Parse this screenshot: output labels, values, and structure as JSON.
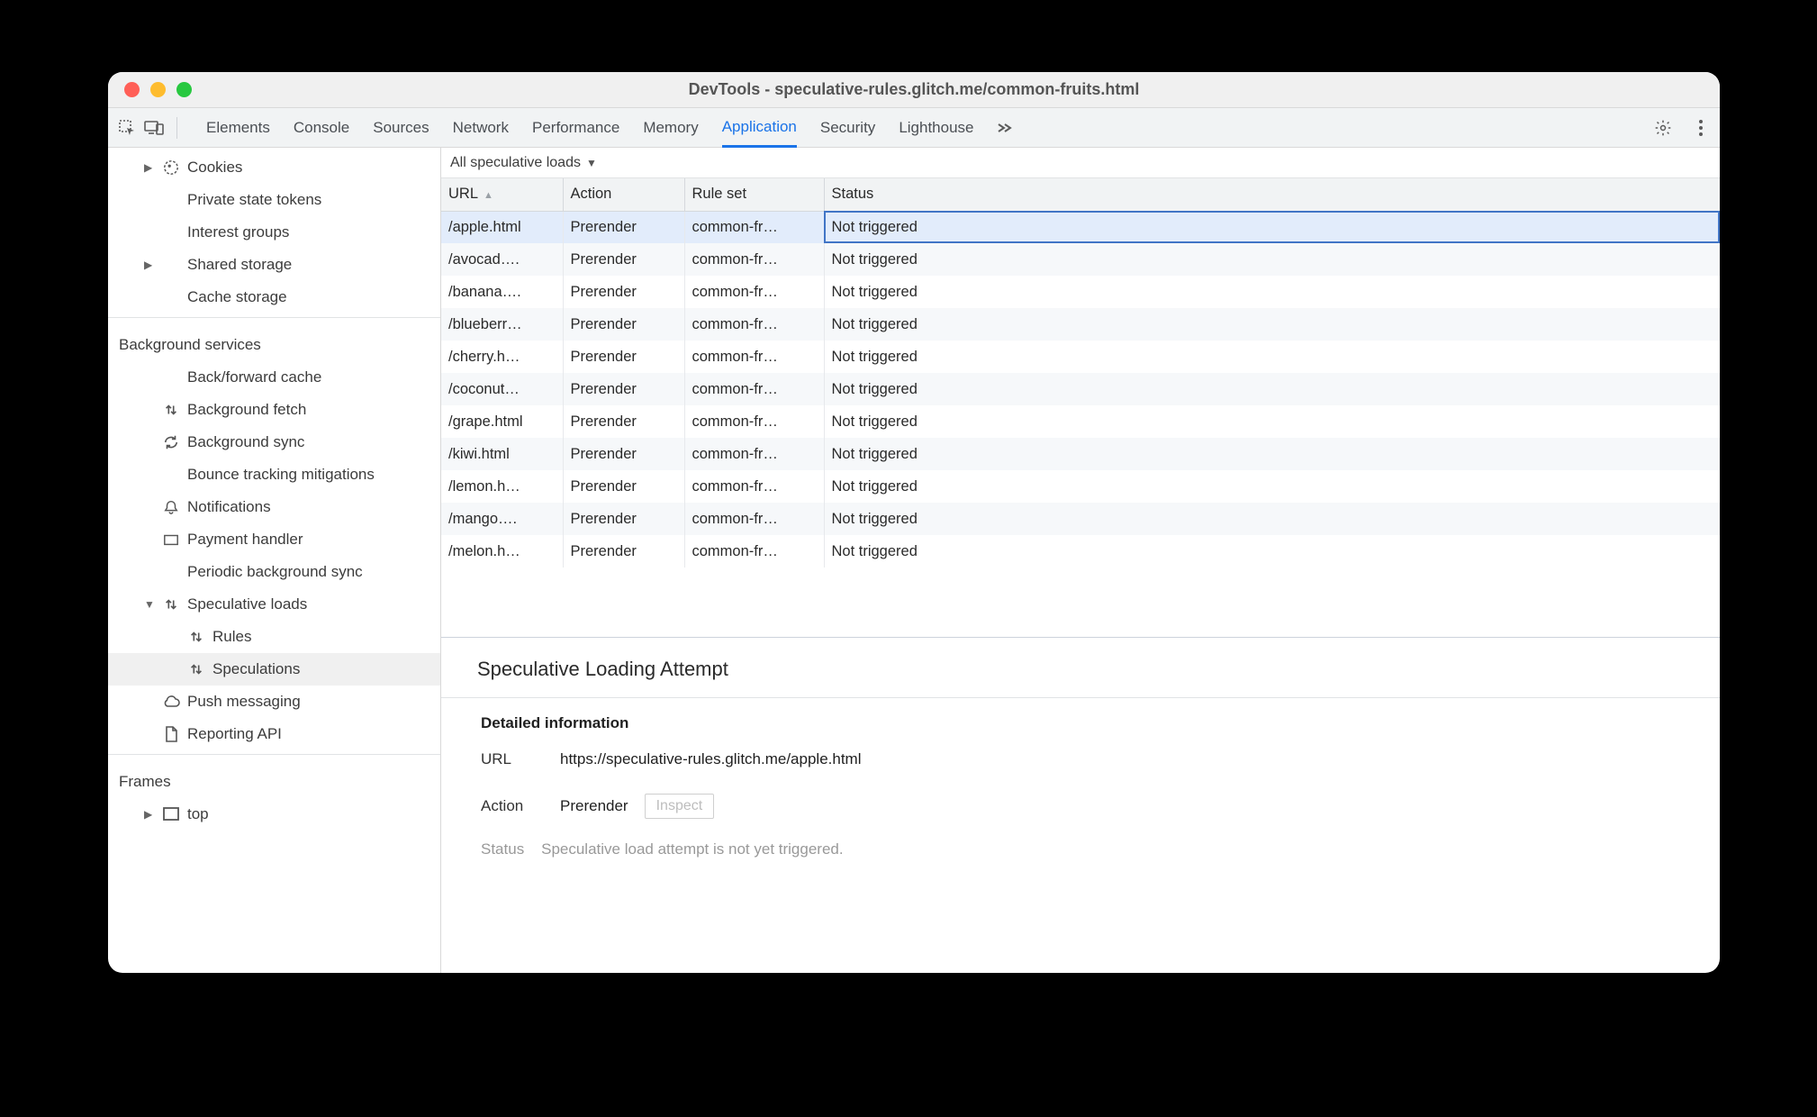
{
  "window": {
    "title": "DevTools - speculative-rules.glitch.me/common-fruits.html"
  },
  "toolbar": {
    "tabs": [
      "Elements",
      "Console",
      "Sources",
      "Network",
      "Performance",
      "Memory",
      "Application",
      "Security",
      "Lighthouse"
    ],
    "active": "Application"
  },
  "sidebar": {
    "storage_items": [
      {
        "label": "Cookies",
        "icon": "cookie",
        "arrow": true,
        "cls": "lvl2"
      },
      {
        "label": "Private state tokens",
        "icon": "db",
        "cls": "lvl2"
      },
      {
        "label": "Interest groups",
        "icon": "db",
        "cls": "lvl2"
      },
      {
        "label": "Shared storage",
        "icon": "db",
        "arrow": true,
        "cls": "lvl2"
      },
      {
        "label": "Cache storage",
        "icon": "db",
        "cls": "lvl2"
      }
    ],
    "section_bg": "Background services",
    "bg_items": [
      {
        "label": "Back/forward cache",
        "icon": "db",
        "cls": "lvl2"
      },
      {
        "label": "Background fetch",
        "icon": "updown",
        "cls": "lvl2"
      },
      {
        "label": "Background sync",
        "icon": "sync",
        "cls": "lvl2"
      },
      {
        "label": "Bounce tracking mitigations",
        "icon": "db",
        "cls": "lvl2"
      },
      {
        "label": "Notifications",
        "icon": "bell",
        "cls": "lvl2"
      },
      {
        "label": "Payment handler",
        "icon": "card",
        "cls": "lvl2"
      },
      {
        "label": "Periodic background sync",
        "icon": "clock",
        "cls": "lvl2"
      },
      {
        "label": "Speculative loads",
        "icon": "updown",
        "cls": "lvl2",
        "arrow": true,
        "expanded": true
      },
      {
        "label": "Rules",
        "icon": "updown",
        "cls": "lvl3"
      },
      {
        "label": "Speculations",
        "icon": "updown",
        "cls": "lvl3",
        "selected": true
      },
      {
        "label": "Push messaging",
        "icon": "cloud",
        "cls": "lvl2"
      },
      {
        "label": "Reporting API",
        "icon": "doc",
        "cls": "lvl2"
      }
    ],
    "section_frames": "Frames",
    "frames_items": [
      {
        "label": "top",
        "icon": "frame",
        "cls": "lvl2",
        "arrow": true
      }
    ]
  },
  "filter": {
    "label": "All speculative loads"
  },
  "table": {
    "columns": [
      "URL",
      "Action",
      "Rule set",
      "Status"
    ],
    "rows": [
      {
        "url": "/apple.html",
        "action": "Prerender",
        "ruleset": "common-fr…",
        "status": "Not triggered",
        "selected": true
      },
      {
        "url": "/avocad….",
        "action": "Prerender",
        "ruleset": "common-fr…",
        "status": "Not triggered"
      },
      {
        "url": "/banana….",
        "action": "Prerender",
        "ruleset": "common-fr…",
        "status": "Not triggered"
      },
      {
        "url": "/blueberr…",
        "action": "Prerender",
        "ruleset": "common-fr…",
        "status": "Not triggered"
      },
      {
        "url": "/cherry.h…",
        "action": "Prerender",
        "ruleset": "common-fr…",
        "status": "Not triggered"
      },
      {
        "url": "/coconut…",
        "action": "Prerender",
        "ruleset": "common-fr…",
        "status": "Not triggered"
      },
      {
        "url": "/grape.html",
        "action": "Prerender",
        "ruleset": "common-fr…",
        "status": "Not triggered"
      },
      {
        "url": "/kiwi.html",
        "action": "Prerender",
        "ruleset": "common-fr…",
        "status": "Not triggered"
      },
      {
        "url": "/lemon.h…",
        "action": "Prerender",
        "ruleset": "common-fr…",
        "status": "Not triggered"
      },
      {
        "url": "/mango….",
        "action": "Prerender",
        "ruleset": "common-fr…",
        "status": "Not triggered"
      },
      {
        "url": "/melon.h…",
        "action": "Prerender",
        "ruleset": "common-fr…",
        "status": "Not triggered"
      }
    ]
  },
  "details": {
    "heading": "Speculative Loading Attempt",
    "sub": "Detailed information",
    "url_label": "URL",
    "url": "https://speculative-rules.glitch.me/apple.html",
    "action_label": "Action",
    "action": "Prerender",
    "inspect": "Inspect",
    "status_label": "Status",
    "status": "Speculative load attempt is not yet triggered."
  }
}
